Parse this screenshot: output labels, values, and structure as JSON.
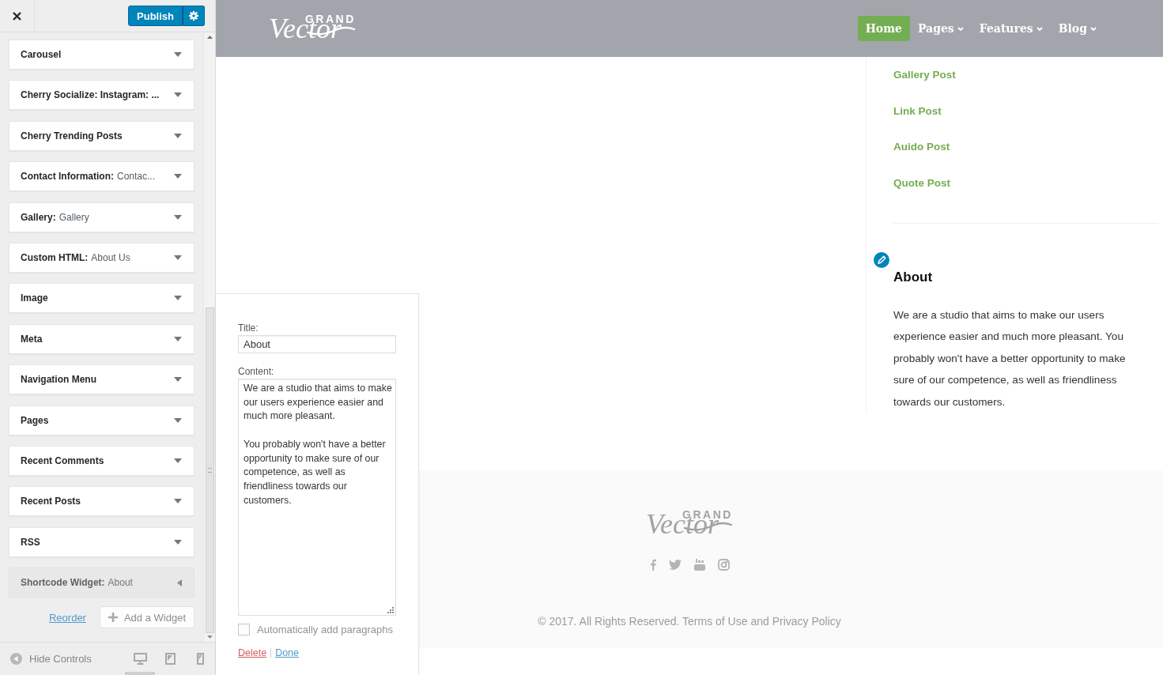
{
  "customizer": {
    "publish": "Publish",
    "widgets": [
      {
        "name": "Carousel",
        "expanded": false
      },
      {
        "name": "Cherry Socialize: Instagram: ...",
        "expanded": false
      },
      {
        "name": "Cherry Trending Posts",
        "expanded": false
      },
      {
        "name": "Contact Information:",
        "subtitle": "Contac...",
        "expanded": false
      },
      {
        "name": "Gallery:",
        "subtitle": "Gallery",
        "expanded": false
      },
      {
        "name": "Custom HTML:",
        "subtitle": "About Us",
        "expanded": false
      },
      {
        "name": "Image",
        "expanded": false
      },
      {
        "name": "Meta",
        "expanded": false
      },
      {
        "name": "Navigation Menu",
        "expanded": false
      },
      {
        "name": "Pages",
        "expanded": false
      },
      {
        "name": "Recent Comments",
        "expanded": false
      },
      {
        "name": "Recent Posts",
        "expanded": false
      },
      {
        "name": "RSS",
        "expanded": false
      },
      {
        "name": "Shortcode Widget:",
        "subtitle": "About",
        "expanded": true
      }
    ],
    "reorder": "Reorder",
    "add_widget": "Add a Widget",
    "footer": {
      "hide_controls": "Hide Controls",
      "devices": [
        {
          "kind": "desktop",
          "selected": true
        },
        {
          "kind": "tablet",
          "selected": false
        },
        {
          "kind": "mobile",
          "selected": false
        }
      ]
    }
  },
  "widget_form": {
    "title_label": "Title:",
    "title_value": "About",
    "content_label": "Content:",
    "content": [
      "We are a studio that aims to make our users experience easier and much more pleasant.",
      "You probably won't have a better opportunity to make sure of our competence, as well as friendliness towards our customers."
    ],
    "auto_paragraphs": {
      "label": "Automatically add paragraphs",
      "checked": false
    },
    "delete": "Delete",
    "done": "Done"
  },
  "preview": {
    "logo": {
      "script": "Vector",
      "tag": "GRAND"
    },
    "nav": [
      {
        "label": "Home",
        "selected": true,
        "dropdown": false
      },
      {
        "label": "Pages",
        "selected": false,
        "dropdown": true
      },
      {
        "label": "Features",
        "selected": false,
        "dropdown": true
      },
      {
        "label": "Blog",
        "selected": false,
        "dropdown": true
      }
    ],
    "menu": [
      "Gallery Post",
      "Link Post",
      "Auido Post",
      "Quote Post"
    ],
    "about": {
      "title": "About",
      "text": "We are a studio that aims to make our users experience easier and much more pleasant. You probably won't have a better opportunity to make sure of our competence, as well as friendliness towards our customers."
    },
    "footer": {
      "logo": {
        "script": "Vector",
        "tag": "GRAND"
      },
      "copyright": "© 2017. All Rights Reserved. Terms of Use and Privacy Policy"
    }
  }
}
